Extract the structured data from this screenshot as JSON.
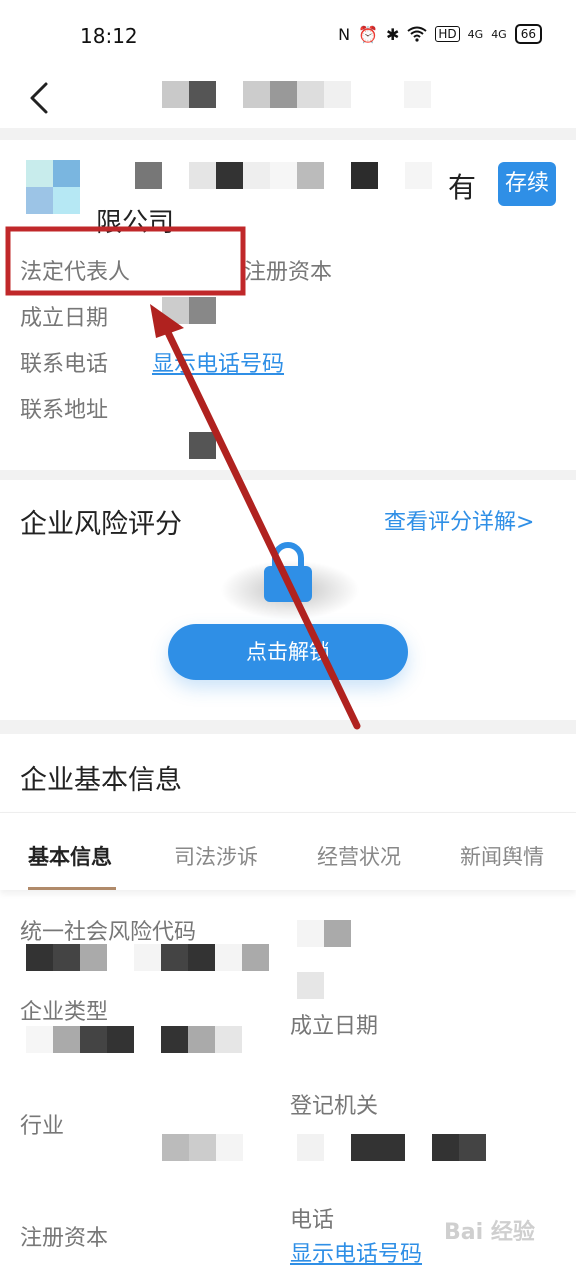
{
  "status_bar": {
    "time": "18:12",
    "icons": [
      "N",
      "⏰",
      "✱",
      "wifi-icon",
      "HD",
      "4G",
      "4G"
    ],
    "battery": "66"
  },
  "company": {
    "name_tail": "有",
    "name_line2": "限公司",
    "badge": "存续"
  },
  "info": {
    "legal_rep_label": "法定代表人",
    "reg_capital_label": "注册资本",
    "founded_label": "成立日期",
    "phone_label": "联系电话",
    "phone_link": "显示电话号码",
    "address_label": "联系地址"
  },
  "risk": {
    "title": "企业风险评分",
    "detail_link": "查看评分详解>",
    "unlock_button": "点击解锁"
  },
  "basic": {
    "title": "企业基本信息",
    "tabs": [
      "基本信息",
      "司法涉诉",
      "经营状况",
      "新闻舆情"
    ],
    "fields": {
      "credit_code": "统一社会风险代码",
      "company_type": "企业类型",
      "industry": "行业",
      "reg_capital": "注册资本",
      "founded": "成立日期",
      "reg_authority": "登记机关",
      "phone": "电话",
      "phone_link": "显示电话号码"
    }
  },
  "watermark": "Bai 经验",
  "colors": {
    "accent": "#2f8fe6",
    "annotation": "#c0282a"
  }
}
